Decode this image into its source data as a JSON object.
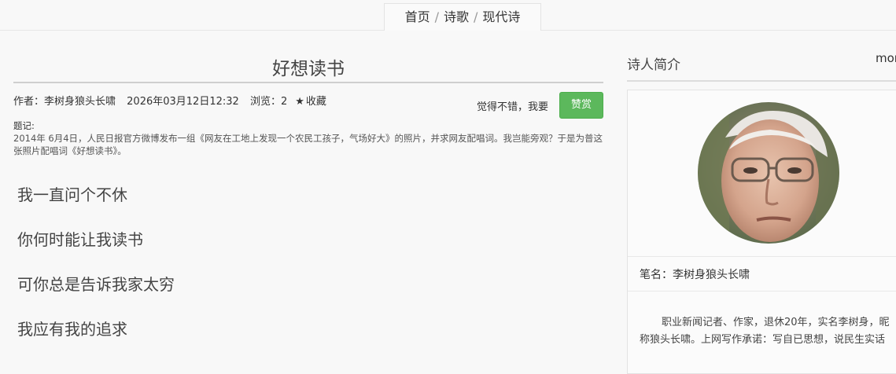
{
  "breadcrumb": {
    "home": "首页",
    "poetry": "诗歌",
    "modern": "现代诗",
    "separator": "/"
  },
  "poem": {
    "title": "好想读书",
    "author_label": "作者：李树身狼头长啸",
    "datetime": "2026年03月12日12:32",
    "views": "浏览：2",
    "favorite": "收藏",
    "like_text": "觉得不错，我要",
    "reward_button": "赞赏",
    "preface_label": "题记:",
    "preface_text": "2014年 6月4日，人民日报官方微博发布一组《网友在工地上发现一个农民工孩子，气场好大》的照片，并求网友配唱词。我岂能旁观？于是为普这张照片配唱词《好想读书》。",
    "lines": [
      "我一直问个不休",
      "你何时能让我读书",
      "可你总是告诉我家太穷",
      "我应有我的追求"
    ]
  },
  "sidebar": {
    "title": "诗人简介",
    "more": "mor",
    "pen_name": "笔名：李树身狼头长啸",
    "bio": "职业新闻记者、作家，退休20年，实名李树身，昵称狼头长啸。上网写作承诺：写自已思想，说民生实话"
  },
  "colors": {
    "accent_green": "#5cb85c",
    "background": "#f8f8f8"
  }
}
